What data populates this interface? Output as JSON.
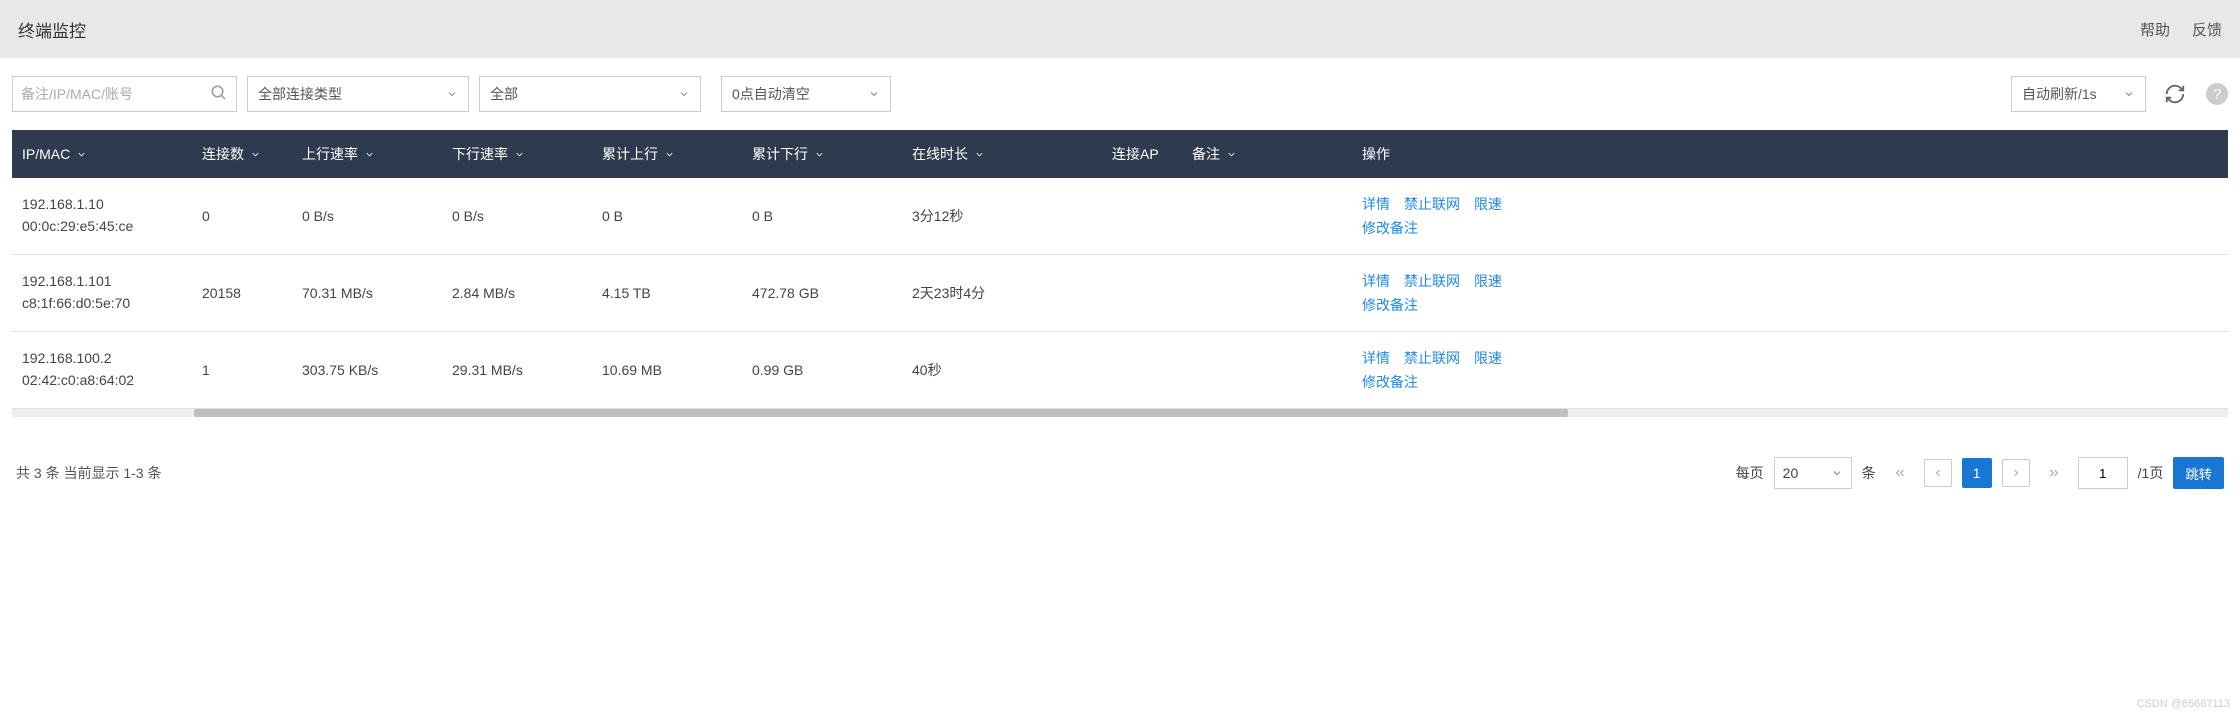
{
  "header": {
    "title": "终端监控",
    "help": "帮助",
    "feedback": "反馈"
  },
  "toolbar": {
    "search_placeholder": "备注/IP/MAC/账号",
    "conn_type": "全部连接类型",
    "all": "全部",
    "auto_clear": "0点自动清空",
    "auto_refresh": "自动刷新/1s"
  },
  "columns": {
    "ipmac": "IP/MAC",
    "conn": "连接数",
    "up": "上行速率",
    "down": "下行速率",
    "tup": "累计上行",
    "tdown": "累计下行",
    "online": "在线时长",
    "ap": "连接AP",
    "note": "备注",
    "action": "操作"
  },
  "actions": {
    "detail": "详情",
    "block": "禁止联网",
    "limit": "限速",
    "edit": "修改备注"
  },
  "rows": [
    {
      "ip": "192.168.1.10",
      "mac": "00:0c:29:e5:45:ce",
      "conn": "0",
      "up": "0 B/s",
      "down": "0 B/s",
      "tup": "0 B",
      "tdown": "0 B",
      "online": "3分12秒",
      "ap": "",
      "note": ""
    },
    {
      "ip": "192.168.1.101",
      "mac": "c8:1f:66:d0:5e:70",
      "conn": "20158",
      "up": "70.31 MB/s",
      "down": "2.84 MB/s",
      "tup": "4.15 TB",
      "tdown": "472.78 GB",
      "online": "2天23时4分",
      "ap": "",
      "note": ""
    },
    {
      "ip": "192.168.100.2",
      "mac": "02:42:c0:a8:64:02",
      "conn": "1",
      "up": "303.75 KB/s",
      "down": "29.31 MB/s",
      "tup": "10.69 MB",
      "tdown": "0.99 GB",
      "online": "40秒",
      "ap": "",
      "note": ""
    }
  ],
  "footer": {
    "summary": "共 3 条 当前显示 1-3 条",
    "per_page_label": "每页",
    "per_page_value": "20",
    "per_page_unit": "条",
    "current_page": "1",
    "total_pages_suffix": "/1页",
    "page_input": "1",
    "jump": "跳转"
  },
  "watermark": "CSDN @65667113"
}
